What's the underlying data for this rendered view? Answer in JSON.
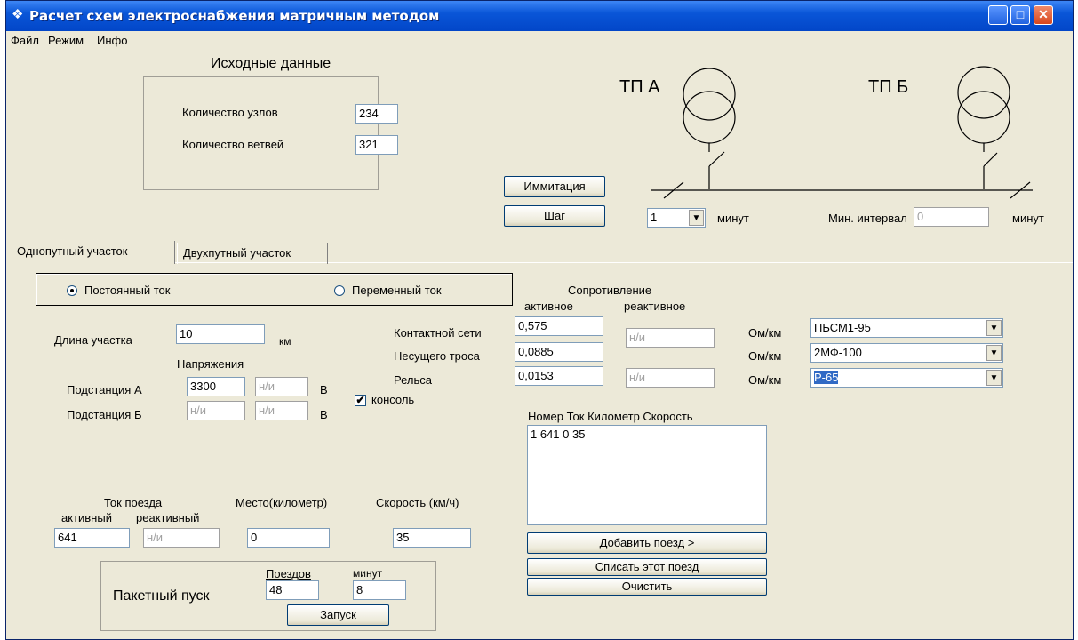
{
  "window": {
    "title": "Расчет схем электроснабжения матричным методом",
    "btn_min": "_",
    "btn_max": "□",
    "btn_close": "✕"
  },
  "menu": [
    "Файл",
    "Режим",
    "Инфо"
  ],
  "source": {
    "title": "Исходные данные",
    "nodes_label": "Количество узлов",
    "nodes_value": "234",
    "branches_label": "Количество ветвей",
    "branches_value": "321"
  },
  "sim": {
    "imitation_label": "Иммитация",
    "step_label": "Шаг",
    "minutes_value": "1",
    "minutes_unit": "минут",
    "min_interval_label": "Мин. интервал",
    "min_interval_value": "0",
    "min_interval_unit": "минут"
  },
  "diagram": {
    "tp_a": "ТП А",
    "tp_b": "ТП Б"
  },
  "tabs": [
    "Однопутный участок",
    "Двухпутный участок"
  ],
  "current": {
    "dc_label": "Постоянный ток",
    "ac_label": "Переменный ток",
    "selected": "dc"
  },
  "section": {
    "length_label": "Длина участка",
    "length_value": "10",
    "length_unit": "км",
    "voltage_title": "Напряжения",
    "sub_a_label": "Подстанция А",
    "sub_a_v1": "3300",
    "sub_a_v2": "н/и",
    "sub_b_label": "Подстанция Б",
    "sub_b_v1": "н/и",
    "sub_b_v2": "н/и",
    "volt_unit": "В",
    "console_label": "консоль",
    "console_checked": true
  },
  "resistance": {
    "title": "Сопротивление",
    "active_header": "активное",
    "reactive_header": "реактивное",
    "rows": [
      {
        "label": "Контактной сети",
        "active": "0,575",
        "reactive": "н/и",
        "unit": "Ом/км",
        "type": "ПБСМ1-95"
      },
      {
        "label": "Несущего троса",
        "active": "0,0885",
        "reactive": "",
        "unit": "Ом/км",
        "type": "2МФ-100"
      },
      {
        "label": "Рельса",
        "active": "0,0153",
        "reactive": "н/и",
        "unit": "Ом/км",
        "type": "Р-65"
      }
    ]
  },
  "trains": {
    "list_header": "Номер  Ток  Километр  Скорость",
    "list_items": [
      "1 641 0 35"
    ],
    "add_btn": "Добавить поезд >",
    "remove_btn": "Списать этот поезд",
    "clear_btn": "Очистить",
    "current_title": "Ток поезда",
    "active_label": "активный",
    "reactive_label": "реактивный",
    "active_value": "641",
    "reactive_value": "н/и",
    "place_label": "Место(километр)",
    "place_value": "0",
    "speed_label": "Скорость (км/ч)",
    "speed_value": "35"
  },
  "batch": {
    "title": "Пакетный пуск",
    "trains_label": "Поездов",
    "trains_value": "48",
    "minutes_label": "минут",
    "minutes_value": "8",
    "start_btn": "Запуск"
  }
}
